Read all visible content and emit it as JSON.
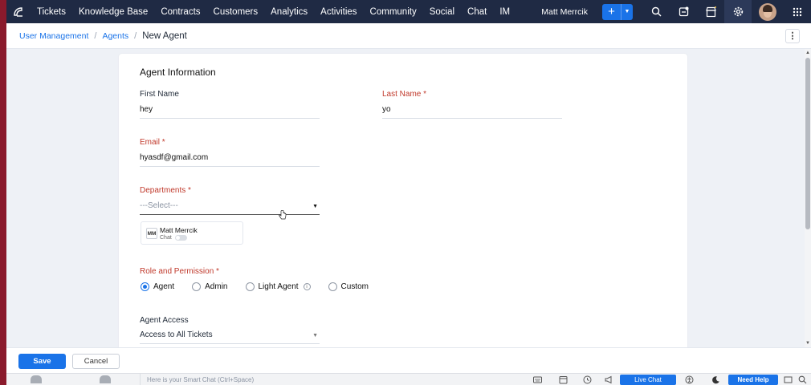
{
  "nav": {
    "items": [
      "Tickets",
      "Knowledge Base",
      "Contracts",
      "Customers",
      "Analytics",
      "Activities",
      "Community",
      "Social",
      "Chat",
      "IM"
    ],
    "user_name": "Matt Merrcik",
    "add_label": "+"
  },
  "breadcrumb": {
    "items": [
      "User Management",
      "Agents"
    ],
    "current": "New Agent"
  },
  "form": {
    "section_title": "Agent Information",
    "first_name": {
      "label": "First Name",
      "value": "hey"
    },
    "last_name": {
      "label": "Last Name *",
      "value": "yo"
    },
    "email": {
      "label": "Email *",
      "value": "hyasdf@gmail.com"
    },
    "departments": {
      "label": "Departments *",
      "placeholder": "---Select---"
    },
    "dept_chip": {
      "initials": "MM",
      "name": "Matt Merrcik",
      "sub": "Chat"
    },
    "role": {
      "label": "Role and Permission *",
      "options": [
        "Agent",
        "Admin",
        "Light Agent",
        "Custom"
      ],
      "selected": "Agent"
    },
    "agent_access": {
      "label": "Agent Access",
      "value": "Access to All Tickets"
    }
  },
  "actions": {
    "save": "Save",
    "cancel": "Cancel"
  },
  "statusbar": {
    "smart_chat_placeholder": "Here is your Smart Chat (Ctrl+Space)",
    "live_chat": "Live Chat",
    "need_help": "Need Help"
  },
  "colors": {
    "accent": "#1a73e8",
    "nav_bg": "#1f2a44",
    "required": "#c0392b"
  }
}
